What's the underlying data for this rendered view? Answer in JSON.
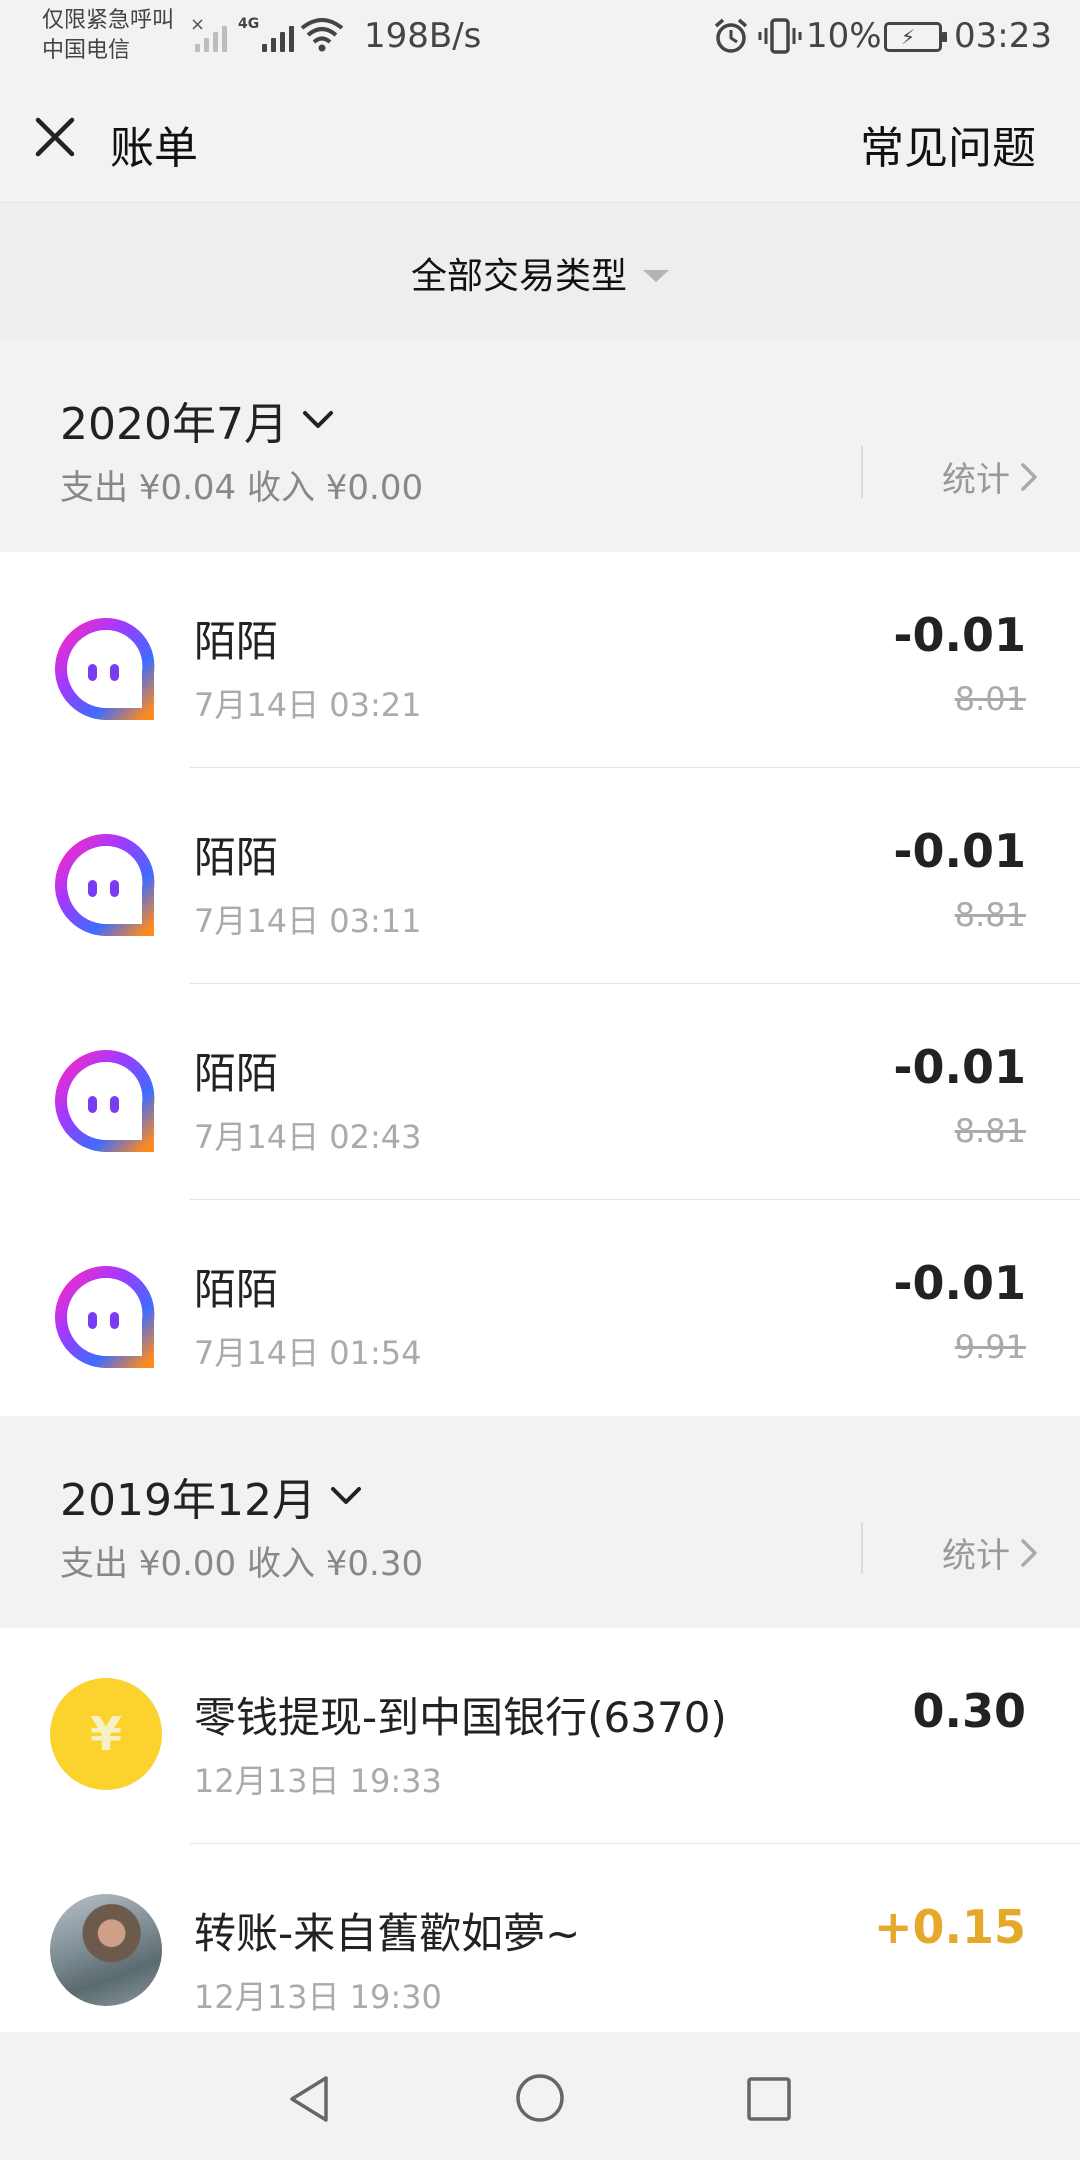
{
  "status_bar": {
    "carrier_line1": "仅限紧急呼叫",
    "carrier_line2": "中国电信",
    "network_type": "4G",
    "speed": "198B/s",
    "battery": "10%",
    "time": "03:23"
  },
  "header": {
    "title": "账单",
    "faq": "常见问题"
  },
  "filter": {
    "label": "全部交易类型"
  },
  "months": [
    {
      "label": "2020年7月",
      "summary": "支出 ¥0.04 收入 ¥0.00",
      "stats": "统计",
      "transactions": [
        {
          "name": "陌陌",
          "time": "7月14日 03:21",
          "amount": "-0.01",
          "balance": "8.01",
          "icon": "momo-app-icon"
        },
        {
          "name": "陌陌",
          "time": "7月14日 03:11",
          "amount": "-0.01",
          "balance": "8.81",
          "icon": "momo-app-icon"
        },
        {
          "name": "陌陌",
          "time": "7月14日 02:43",
          "amount": "-0.01",
          "balance": "8.81",
          "icon": "momo-app-icon"
        },
        {
          "name": "陌陌",
          "time": "7月14日 01:54",
          "amount": "-0.01",
          "balance": "9.91",
          "icon": "momo-app-icon"
        }
      ]
    },
    {
      "label": "2019年12月",
      "summary": "支出 ¥0.00 收入 ¥0.30",
      "stats": "统计",
      "transactions": [
        {
          "name": "零钱提现-到中国银行(6370)",
          "time": "12月13日 19:33",
          "amount": "0.30",
          "icon": "yuan-coin-icon",
          "coin_symbol": "¥"
        },
        {
          "name": "转账-来自舊歡如夢~",
          "time": "12月13日 19:30",
          "amount": "+0.15",
          "icon": "user-avatar"
        }
      ]
    }
  ],
  "colors": {
    "income": "#e6a82a",
    "coin": "#fcd22f",
    "background": "#f2f2f2"
  }
}
